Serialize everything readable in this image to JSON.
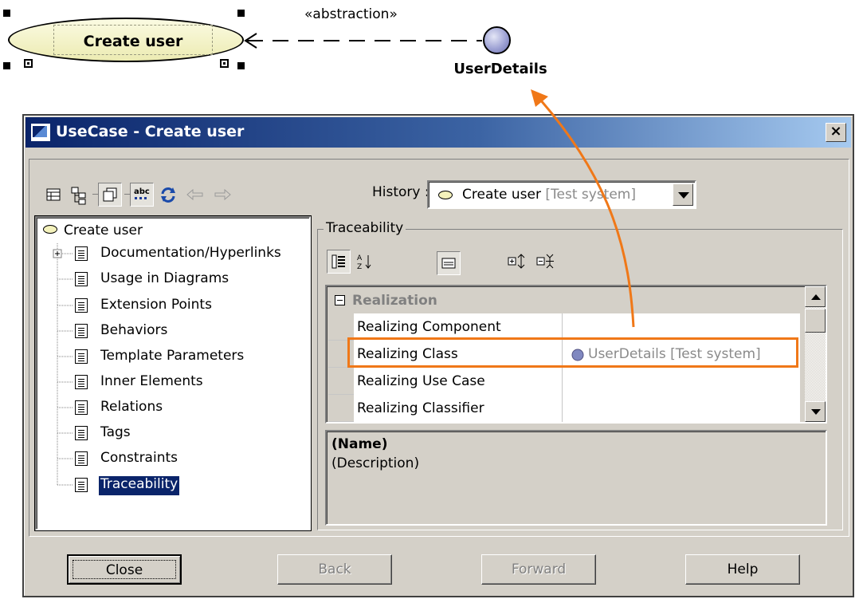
{
  "diagram": {
    "use_case_label": "Create user",
    "stereotype": "«abstraction»",
    "interface_name": "UserDetails"
  },
  "dialog": {
    "title": "UseCase - Create user",
    "close_glyph": "×",
    "history_label": "History :",
    "history_value": "Create user",
    "history_owner": "[Test system]"
  },
  "tree": {
    "root": "Create user",
    "items": [
      "Documentation/Hyperlinks",
      "Usage in Diagrams",
      "Extension Points",
      "Behaviors",
      "Template Parameters",
      "Inner Elements",
      "Relations",
      "Tags",
      "Constraints",
      "Traceability"
    ],
    "selected_item": "Traceability"
  },
  "traceability": {
    "group_title": "Traceability",
    "category": "Realization",
    "rows": [
      {
        "name": "Realizing Component",
        "value": ""
      },
      {
        "name": "Realizing Class",
        "value": "UserDetails [Test system]"
      },
      {
        "name": "Realizing Use Case",
        "value": ""
      },
      {
        "name": "Realizing Classifier",
        "value": ""
      }
    ],
    "description_name": "(Name)",
    "description_text": "(Description)"
  },
  "buttons": {
    "close": "Close",
    "back": "Back",
    "forward": "Forward",
    "help": "Help"
  },
  "colors": {
    "highlight": "#f07818",
    "title_bar_start": "#0a246a",
    "selection": "#0a246a"
  }
}
